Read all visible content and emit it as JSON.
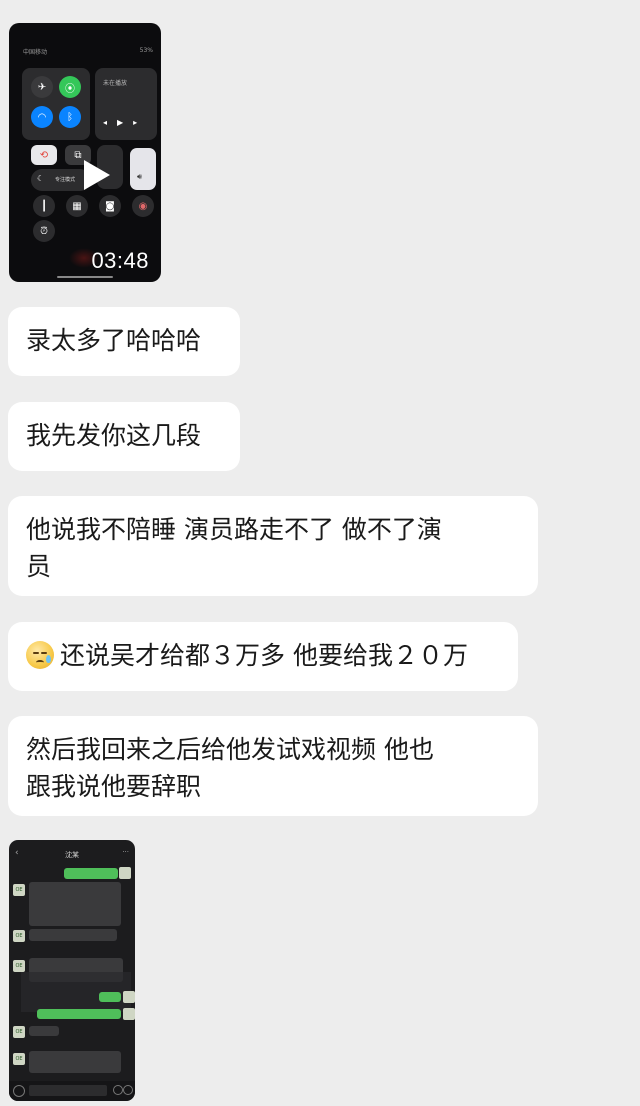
{
  "video": {
    "duration": "03:48",
    "status_carrier": "中国移动",
    "status_battery": "53%",
    "music_title": "未在播放",
    "focus_label": "专注模式"
  },
  "messages": [
    {
      "lines": [
        "录太多了哈哈哈"
      ]
    },
    {
      "lines": [
        "我先发你这几段"
      ]
    },
    {
      "lines": [
        "他说我不陪睡 演员路走不了 做不了演",
        "员"
      ]
    },
    {
      "emoji": "sad-tear-face",
      "lines": [
        "还说吴才给都３万多 他要给我２０万"
      ]
    },
    {
      "lines": [
        "然后我回来之后给他发试戏视频 他也",
        "跟我说他要辞职"
      ]
    }
  ],
  "chat_screenshot": {
    "title": "沈某",
    "avatar_text": "OE"
  },
  "colors": {
    "background": "#ededed",
    "bubble": "#ffffff",
    "text": "#1a1a1a"
  }
}
